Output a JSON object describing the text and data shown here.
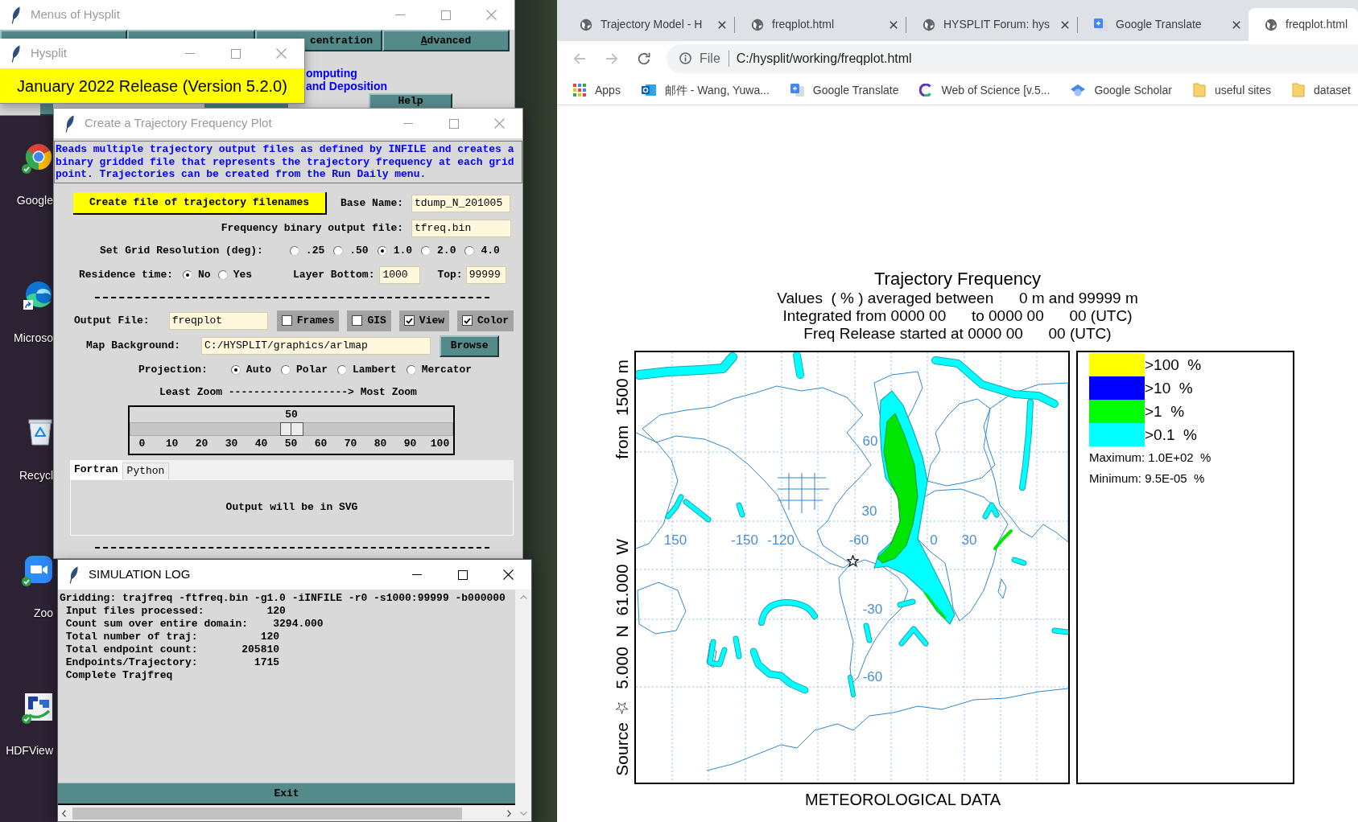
{
  "desktop": {
    "icons": [
      {
        "label": "Google",
        "kind": "wheel",
        "synced": true,
        "shortcut": false
      },
      {
        "label": "Microso",
        "kind": "wave",
        "synced": false,
        "shortcut": true
      },
      {
        "label": "Recycl",
        "kind": "bin",
        "synced": false,
        "shortcut": false
      },
      {
        "label": "Zoo",
        "kind": "camera",
        "synced": true,
        "shortcut": false
      },
      {
        "label": "HDFView",
        "kind": "tile",
        "synced": true,
        "shortcut": false
      }
    ]
  },
  "menus_window": {
    "title": "Menus of Hysplit",
    "active": false,
    "tabs": [
      {
        "label": "centration",
        "mnemonic": false
      },
      {
        "label": "Advanced",
        "mnemonic": true
      }
    ],
    "intro_lines": [
      "omputing",
      "and Deposition"
    ],
    "help_button": "Help"
  },
  "hysplit_window": {
    "title": "Hysplit",
    "active": false,
    "release": "January 2022 Release (Version 5.2.0)"
  },
  "freq_dialog": {
    "title": "Create a Trajectory Frequency Plot",
    "active": false,
    "description": "Reads multiple trajectory output files as defined by INFILE and creates a binary gridded file that represents the trajectory frequency at each grid point. Trajectories can be created from the Run Daily menu.",
    "create_button": "Create file of trajectory filenames",
    "base_name": {
      "label": "Base Name:",
      "value": "tdump_N_201005"
    },
    "binary_output": {
      "label": "Frequency binary output file:",
      "value": "tfreq.bin"
    },
    "grid_resolution": {
      "label": "Set Grid Resolution (deg):",
      "options": [
        {
          "label": ".25",
          "selected": false
        },
        {
          "label": ".50",
          "selected": false
        },
        {
          "label": "1.0",
          "selected": true
        },
        {
          "label": "2.0",
          "selected": false
        },
        {
          "label": "4.0",
          "selected": false
        }
      ]
    },
    "residence_time": {
      "label": "Residence time:",
      "options": [
        {
          "label": "No",
          "selected": true
        },
        {
          "label": "Yes",
          "selected": false
        }
      ]
    },
    "layer_bottom": {
      "label": "Layer Bottom:",
      "value": "1000"
    },
    "layer_top": {
      "label": "Top:",
      "value": "99999"
    },
    "output_file": {
      "label": "Output File:",
      "value": "freqplot"
    },
    "toggles": [
      {
        "label": "Frames",
        "checked": false
      },
      {
        "label": "GIS",
        "checked": false
      },
      {
        "label": "View",
        "checked": true
      },
      {
        "label": "Color",
        "checked": true
      }
    ],
    "map_background": {
      "label": "Map Background:",
      "value": "C:/HYSPLIT/graphics/arlmap",
      "button": "Browse"
    },
    "projection": {
      "label": "Projection:",
      "options": [
        {
          "label": "Auto",
          "selected": true
        },
        {
          "label": "Polar",
          "selected": false
        },
        {
          "label": "Lambert",
          "selected": false
        },
        {
          "label": "Mercator",
          "selected": false
        }
      ]
    },
    "zoom": {
      "caption": "Least Zoom -------------------> Most Zoom",
      "value": "50",
      "level": 0.5,
      "ticks": [
        "0",
        "10",
        "20",
        "30",
        "40",
        "50",
        "60",
        "70",
        "80",
        "90",
        "100"
      ]
    },
    "tabs": [
      {
        "label": "Fortran",
        "selected": true
      },
      {
        "label": "Python",
        "selected": false
      }
    ],
    "tab_panel_text": "Output will be in SVG"
  },
  "log_window": {
    "title": "SIMULATION LOG",
    "active": true,
    "lines": [
      "Gridding: trajfreq -ftfreq.bin -g1.0 -iINFILE -r0 -s1000:99999 -b000000",
      " Input files processed:          120",
      " Count sum over entire domain:    3294.000",
      " Total number of traj:          120",
      " Total endpoint count:       205810",
      " Endpoints/Trajectory:         1715",
      " Complete Trajfreq"
    ],
    "exit_button": "Exit"
  },
  "browser": {
    "tabs": [
      {
        "title": "Trajectory Model - H",
        "kind": "globe",
        "selected": false
      },
      {
        "title": "freqplot.html",
        "kind": "globe",
        "selected": false
      },
      {
        "title": "HYSPLIT Forum: hys",
        "kind": "globe",
        "selected": false
      },
      {
        "title": "Google Translate",
        "kind": "cards",
        "selected": false
      },
      {
        "title": "freqplot.html",
        "kind": "globe",
        "selected": true
      }
    ],
    "back_disabled": true,
    "forward_disabled": true,
    "address": {
      "scheme": "File",
      "url": "C:/hysplit/working/freqplot.html"
    },
    "bookmarks": [
      {
        "label": "Apps",
        "kind": "apps"
      },
      {
        "label": "邮件 - Wang, Yuwa...",
        "kind": "mail"
      },
      {
        "label": "Google Translate",
        "kind": "cards"
      },
      {
        "label": "Web of Science [v.5...",
        "kind": "arc"
      },
      {
        "label": "Google Scholar",
        "kind": "cap"
      },
      {
        "label": "useful sites",
        "kind": "folder"
      },
      {
        "label": "dataset",
        "kind": "folder"
      }
    ]
  },
  "plot": {
    "title": "Trajectory Frequency",
    "subtitle_lines": [
      "Values  ( % ) averaged between      0 m and 99999 m",
      "Integrated from 0000 00      to 0000 00      00 (UTC)",
      "Freq Release started at 0000 00      00 (UTC)"
    ],
    "ylabel": "Source ☆  5.000  N  61.000  W                 from  1500 m",
    "xlabel": "METEOROLOGICAL DATA",
    "map": {
      "lon_labels": [
        "150",
        "-150",
        "-120",
        "-60",
        "0",
        "30"
      ],
      "lat_labels": [
        "60",
        "30",
        "-30",
        "-60"
      ]
    },
    "legend": {
      "items": [
        {
          "label": ">100  %",
          "color": "#ffff00"
        },
        {
          "label": ">10  %",
          "color": "#0000ff"
        },
        {
          "label": ">1  %",
          "color": "#00ff00"
        },
        {
          "label": ">0.1  %",
          "color": "#00ffff"
        }
      ],
      "maximum": "Maximum: 1.0E+02  %",
      "minimum": "Minimum: 9.5E-05  %"
    }
  }
}
